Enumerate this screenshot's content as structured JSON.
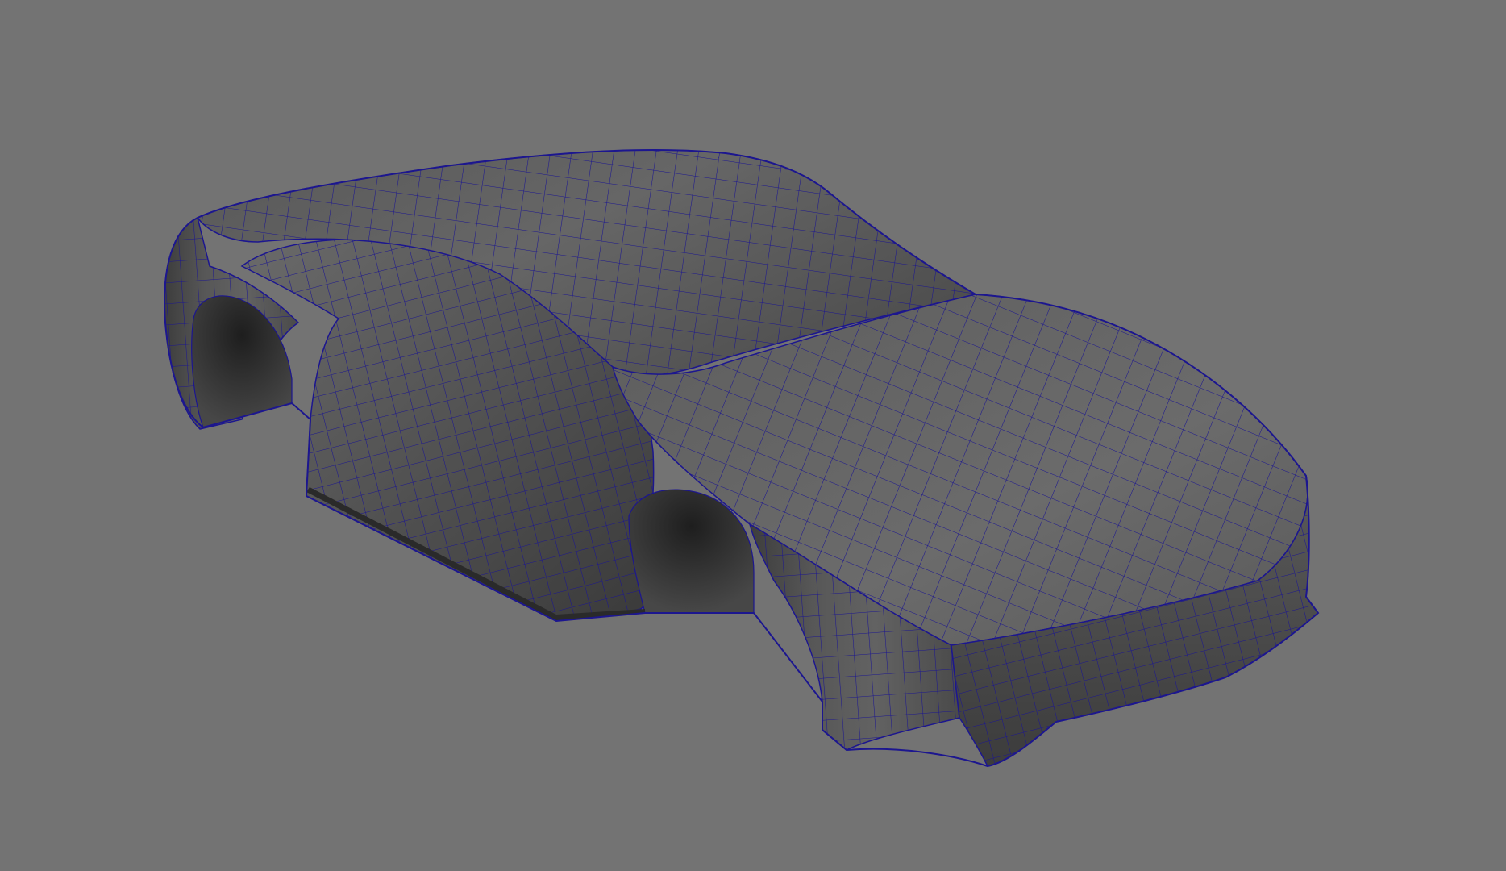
{
  "viewport": {
    "background_color": "#737373"
  },
  "model": {
    "object": "car-body-blockout",
    "display_mode": "smooth-shaded-with-wireframe-on-shaded",
    "surface_color_light": "#6b6b6b",
    "surface_color_dark": "#2e2e2e",
    "wireframe_color": "#1a148c"
  }
}
